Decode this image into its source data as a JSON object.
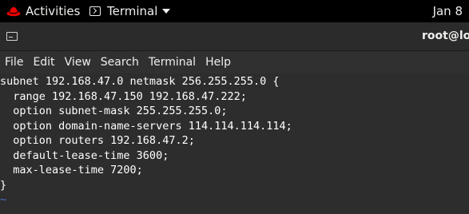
{
  "topbar": {
    "activities_label": "Activities",
    "app_menu_label": "Terminal",
    "clock": "Jan 8",
    "hat_color": "#ee0000"
  },
  "titlebar": {
    "title": "root@loc"
  },
  "menubar": {
    "items": [
      "File",
      "Edit",
      "View",
      "Search",
      "Terminal",
      "Help"
    ]
  },
  "terminal": {
    "lines": [
      "subnet 192.168.47.0 netmask 256.255.255.0 {",
      "  range 192.168.47.150 192.168.47.222;",
      "  option subnet-mask 255.255.255.0;",
      "  option domain-name-servers 114.114.114.114;",
      "  option routers 192.168.47.2;",
      "  default-lease-time 3600;",
      "  max-lease-time 7200;",
      "}"
    ],
    "tilde_lines": [
      "~",
      "~"
    ],
    "text_color": "#ffffff",
    "tilde_color": "#4a6fd1"
  }
}
